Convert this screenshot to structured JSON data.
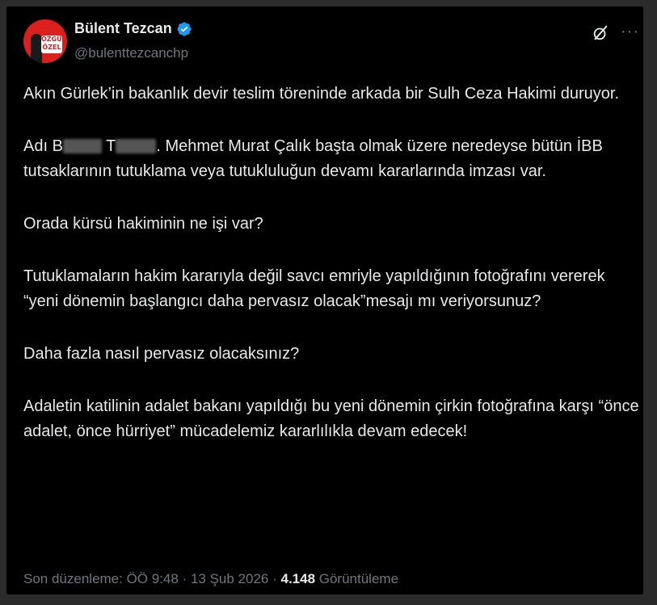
{
  "author": {
    "name": "Bülent Tezcan",
    "handle": "@bulenttezcanchp",
    "avatar_badge": "ÖZGÜR ÖZEL",
    "verified_color": "#1d9bf0"
  },
  "actions": {
    "grok_icon": "grok-icon",
    "more_label": "···"
  },
  "tweet": {
    "p1": "Akın Gürlek’in bakanlık devir teslim töreninde arkada bir Sulh Ceza Hakimi duruyor.",
    "p2_prefix": "Adı B",
    "p2_mid": "T",
    "p2_rest": ". Mehmet Murat Çalık başta olmak üzere neredeyse bütün İBB tutsaklarının tutuklama veya tutukluluğun devamı kararlarında imzası var.",
    "p3": "Orada kürsü hakiminin ne işi var?",
    "p4": "Tutuklamaların hakim kararıyla değil savcı emriyle yapıldığının fotoğrafını vererek “yeni dönemin başlangıcı daha pervasız olacak”mesajı mı veriyorsunuz?",
    "p5": "Daha fazla nasıl pervasız olacaksınız?",
    "p6": "Adaletin katilinin adalet bakanı yapıldığı bu yeni dönemin çirkin fotoğrafına karşı “önce adalet, önce hürriyet” mücadelemiz kararlılıkla devam edecek!"
  },
  "meta": {
    "edited": "Son düzenleme: ÖÖ 9:48 · 13 Şub 2026 · ",
    "views_count": "4.148",
    "views_label": " Görüntüleme"
  }
}
